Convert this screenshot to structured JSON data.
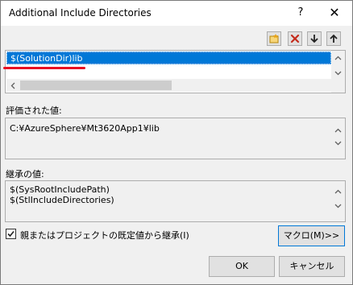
{
  "window": {
    "title": "Additional Include Directories",
    "help_glyph": "?",
    "close_glyph": "✕"
  },
  "toolbar": {
    "icons": [
      "new-line-icon",
      "delete-icon",
      "move-down-icon",
      "move-up-icon"
    ]
  },
  "directories": {
    "items": [
      "$(SolutionDir)lib"
    ],
    "selected_index": 0
  },
  "evaluated": {
    "label": "評価された値:",
    "lines": [
      "C:¥AzureSphere¥Mt3620App1¥lib"
    ]
  },
  "inherited": {
    "label": "継承の値:",
    "lines": [
      "$(SysRootIncludePath)",
      "$(StlIncludeDirectories)"
    ]
  },
  "inherit_checkbox": {
    "label": "親またはプロジェクトの既定値から継承(I)",
    "checked": true
  },
  "buttons": {
    "macro": "マクロ(M)>>",
    "ok": "OK",
    "cancel": "キャンセル"
  },
  "colors": {
    "selection": "#0078d7",
    "annotation_underline": "#e81123",
    "delete_icon": "#c42b1c",
    "new_line_icon": "#e8a317"
  }
}
